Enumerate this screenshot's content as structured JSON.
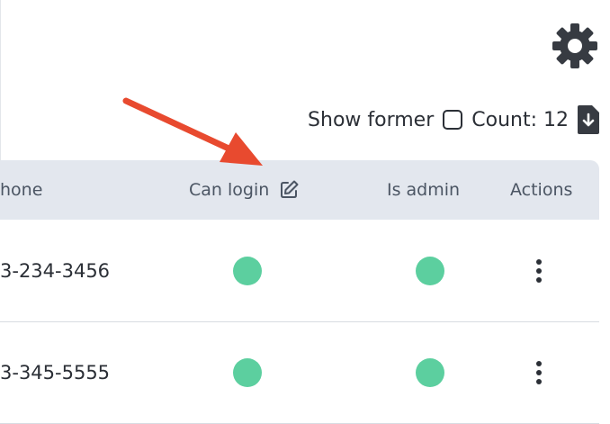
{
  "toolbar": {
    "show_former_label": "Show former",
    "show_former_checked": false,
    "count_label": "Count: 12"
  },
  "table": {
    "columns": [
      "hone",
      "Can login",
      "Is admin",
      "Actions"
    ],
    "rows": [
      {
        "phone": "3-234-3456",
        "can_login": true,
        "is_admin": true
      },
      {
        "phone": "3-345-5555",
        "can_login": true,
        "is_admin": true
      }
    ]
  },
  "icons": {
    "gear": "gear-icon",
    "download": "download-icon",
    "edit": "pencil-edit-icon",
    "more": "more-vertical-icon",
    "annotation": "red-arrow"
  },
  "colors": {
    "status_dot": "#5ccf9f",
    "header_bg": "#e3e7ee",
    "arrow": "#e84a2f"
  }
}
